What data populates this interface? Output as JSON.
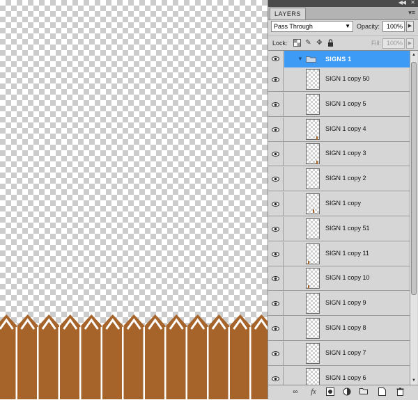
{
  "panel": {
    "tab_label": "LAYERS",
    "menu_icon": "panel-menu-icon",
    "blend_mode": "Pass Through",
    "opacity_label": "Opacity:",
    "opacity_value": "100%",
    "lock_label": "Lock:",
    "fill_label": "Fill:",
    "fill_value": "100%"
  },
  "group": {
    "name": "SIGNS 1",
    "selected_color": "#3d9bf5"
  },
  "layers": [
    "SIGN 1 copy 50",
    "SIGN 1 copy 5",
    "SIGN 1 copy 4",
    "SIGN 1 copy 3",
    "SIGN 1 copy 2",
    "SIGN 1 copy",
    "SIGN 1 copy 51",
    "SIGN 1 copy 11",
    "SIGN 1 copy 10",
    "SIGN 1 copy 9",
    "SIGN 1 copy 8",
    "SIGN 1 copy 7",
    "SIGN 1 copy 6"
  ],
  "bottom_icons": [
    "link-layers-icon",
    "fx-icon",
    "layer-mask-icon",
    "adjustment-layer-icon",
    "new-group-icon",
    "new-layer-icon",
    "trash-icon"
  ],
  "colors": {
    "fence": "#a6632a",
    "fence_stripe": "#ffffff"
  }
}
